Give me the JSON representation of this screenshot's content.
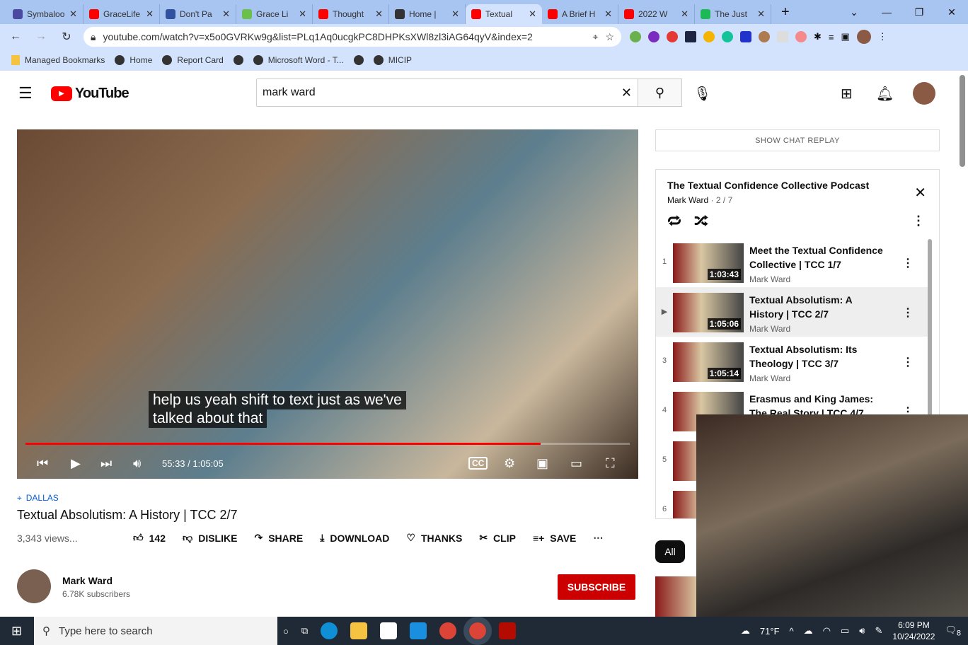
{
  "browser": {
    "tabs": [
      {
        "title": "Symbaloo",
        "color": "#4a4aa0",
        "active": false
      },
      {
        "title": "GraceLife",
        "color": "#f00",
        "active": false
      },
      {
        "title": "Don't Pa",
        "color": "#3050a0",
        "active": false
      },
      {
        "title": "Grace Li",
        "color": "#6ac04a",
        "active": false
      },
      {
        "title": "Thought",
        "color": "#f00",
        "active": false
      },
      {
        "title": "Home |",
        "color": "#333",
        "active": false
      },
      {
        "title": "Textual",
        "color": "#f00",
        "active": true
      },
      {
        "title": "A Brief H",
        "color": "#f00",
        "active": false
      },
      {
        "title": "2022 W",
        "color": "#f00",
        "active": false
      },
      {
        "title": "The Just",
        "color": "#1db954",
        "active": false
      }
    ],
    "url": "youtube.com/watch?v=x5o0GVRKw9g&list=PLq1Aq0ucgkPC8DHPKsXWl8zl3iAG64qyV&index=2",
    "bookmarks": [
      "Managed Bookmarks",
      "Home",
      "Report Card",
      "",
      "Microsoft Word - T...",
      "",
      "MICIP"
    ]
  },
  "youtube": {
    "logo": "YouTube",
    "search_value": "mark ward",
    "video": {
      "caption_lines": [
        "help us yeah shift to text just as we've",
        "talked about that"
      ],
      "time": "55:33 / 1:05:05",
      "progress": 0.853,
      "location": "DALLAS",
      "title": "Textual Absolutism: A History | TCC 2/7",
      "views": "3,343 views...",
      "likes": "142",
      "actions": [
        "DISLIKE",
        "SHARE",
        "DOWNLOAD",
        "THANKS",
        "CLIP",
        "SAVE"
      ],
      "channel": "Mark Ward",
      "subscribers": "6.78K subscribers",
      "subscribe_label": "SUBSCRIBE"
    },
    "chat_replay": "SHOW CHAT REPLAY",
    "playlist": {
      "title": "The Textual Confidence Collective Podcast",
      "owner": "Mark Ward",
      "position": "2 / 7",
      "items": [
        {
          "index": "1",
          "title": "Meet the Textual Confidence Collective | TCC 1/7",
          "channel": "Mark Ward",
          "duration": "1:03:43"
        },
        {
          "index": "▶",
          "title": "Textual Absolutism: A History | TCC 2/7",
          "channel": "Mark Ward",
          "duration": "1:05:06"
        },
        {
          "index": "3",
          "title": "Textual Absolutism: Its Theology | TCC 3/7",
          "channel": "Mark Ward",
          "duration": "1:05:14"
        },
        {
          "index": "4",
          "title": "Erasmus and King James: The Real Story | TCC 4/7",
          "channel": "",
          "duration": ""
        },
        {
          "index": "5",
          "title": "",
          "channel": "",
          "duration": ""
        },
        {
          "index": "6",
          "title": "",
          "channel": "",
          "duration": ""
        }
      ]
    },
    "chip_all": "All"
  },
  "taskbar": {
    "search_placeholder": "Type here to search",
    "weather": "71°F",
    "time": "6:09 PM",
    "date": "10/24/2022",
    "notifications": "8"
  }
}
